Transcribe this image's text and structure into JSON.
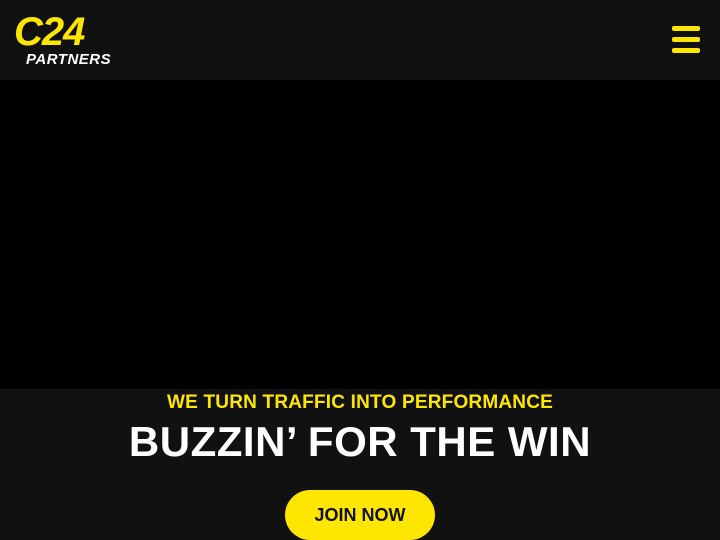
{
  "brand": {
    "logo_main": "C24",
    "logo_sub": "PARTNERS",
    "accent_color": "#FFE600"
  },
  "header": {
    "menu_icon": "hamburger-menu-icon"
  },
  "hero": {
    "tagline": "WE TURN TRAFFIC INTO PERFORMANCE",
    "headline": "BUZZIN’ FOR THE WIN",
    "cta_label": "JOIN NOW"
  }
}
